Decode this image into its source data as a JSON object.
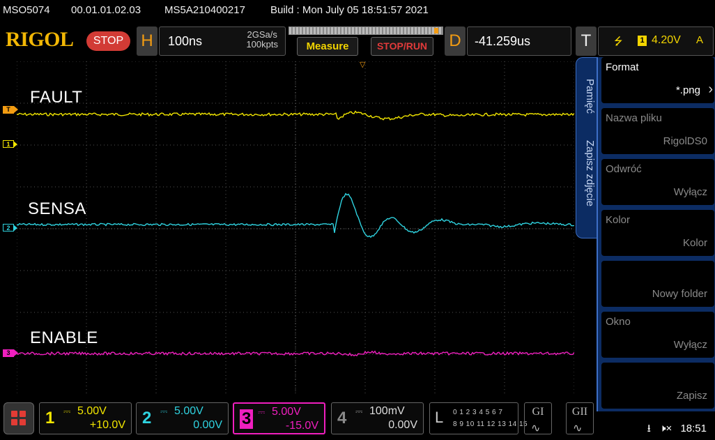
{
  "status_line": {
    "model": "MSO5074",
    "firmware": "00.01.01.02.03",
    "serial": "MS5A210400217",
    "build": "Build : Mon July 05 18:51:57 2021"
  },
  "toolbar": {
    "logo": "RIGOL",
    "run_state": "STOP",
    "horizontal": {
      "letter": "H",
      "timebase": "100ns",
      "sample_rate": "2GSa/s",
      "memory_depth": "100kpts"
    },
    "measure_label": "Measure",
    "stop_run_label": "STOP/RUN",
    "delay": {
      "letter": "D",
      "offset": "-41.259us"
    },
    "trigger": {
      "letter": "T",
      "edge_icon": "rising-edge-icon",
      "source": "1",
      "level": "4.20V",
      "mode": "A"
    }
  },
  "colors": {
    "ch1": "#f2e600",
    "ch2": "#2fd3e0",
    "ch3": "#f01fbf",
    "ch4": "#8a8a8a",
    "accent": "#f39c12",
    "menu_bg": "#0c2c63",
    "stop_red": "#d23b35"
  },
  "traces": {
    "ch1_label": "FAULT",
    "ch2_label": "SENSA",
    "ch3_label": "ENABLE"
  },
  "markers": {
    "trigger": "T",
    "ch1": "1",
    "ch2": "2",
    "ch3": "3",
    "trig_pos": "▽"
  },
  "menu": {
    "tabs": [
      "Pamięć",
      "Zapisz zdjęcie"
    ],
    "items": [
      {
        "title": "Format",
        "value": "*.png",
        "enabled": true,
        "has_arrow": true
      },
      {
        "title": "Nazwa pliku",
        "value": "RigolDS0",
        "enabled": false,
        "has_arrow": false
      },
      {
        "title": "Odwróć",
        "value": "Wyłącz",
        "enabled": false,
        "has_arrow": false
      },
      {
        "title": "Kolor",
        "value": "Kolor",
        "enabled": false,
        "has_arrow": false
      },
      {
        "title": "",
        "value": "Nowy folder",
        "enabled": false,
        "has_arrow": false
      },
      {
        "title": "Okno",
        "value": "Wyłącz",
        "enabled": false,
        "has_arrow": false
      },
      {
        "title": "",
        "value": "Zapisz",
        "enabled": false,
        "has_arrow": false
      }
    ]
  },
  "channels": [
    {
      "num": "1",
      "scale": "5.00V",
      "offset": "+10.0V",
      "active": false
    },
    {
      "num": "2",
      "scale": "5.00V",
      "offset": "0.00V",
      "active": false
    },
    {
      "num": "3",
      "scale": "5.00V",
      "offset": "-15.0V",
      "active": true
    },
    {
      "num": "4",
      "scale": "100mV",
      "offset": "0.00V",
      "active": false
    }
  ],
  "logic_analyzer": {
    "letter": "L",
    "row1": "0 1 2 3  4 5 6 7",
    "row2": "8 9 10 11 12 13 14 15"
  },
  "generators": [
    {
      "label": "GI",
      "wave_icon": "sine-wave-icon"
    },
    {
      "label": "GII",
      "wave_icon": "sine-wave-icon"
    }
  ],
  "system": {
    "usb_icon": "usb-icon",
    "sound_icon": "sound-muted-icon",
    "clock": "18:51"
  }
}
